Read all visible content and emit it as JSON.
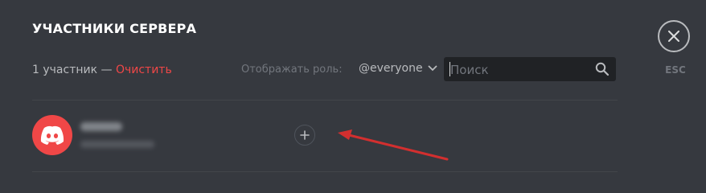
{
  "header": {
    "title": "УЧАСТНИКИ СЕРВЕРА",
    "member_count": "1 участник —",
    "clear_label": "Очистить"
  },
  "filter": {
    "role_label": "Отображать роль:",
    "role_value": "@everyone"
  },
  "search": {
    "placeholder": "Поиск"
  },
  "close": {
    "esc_label": "ESC"
  },
  "member": {
    "add_role_symbol": "+"
  },
  "colors": {
    "background": "#36393f",
    "accent_red": "#f04747",
    "annotation_arrow": "#d22f2f"
  },
  "icons": [
    "close-icon",
    "chevron-down-icon",
    "search-icon",
    "discord-logo-icon",
    "plus-icon"
  ]
}
